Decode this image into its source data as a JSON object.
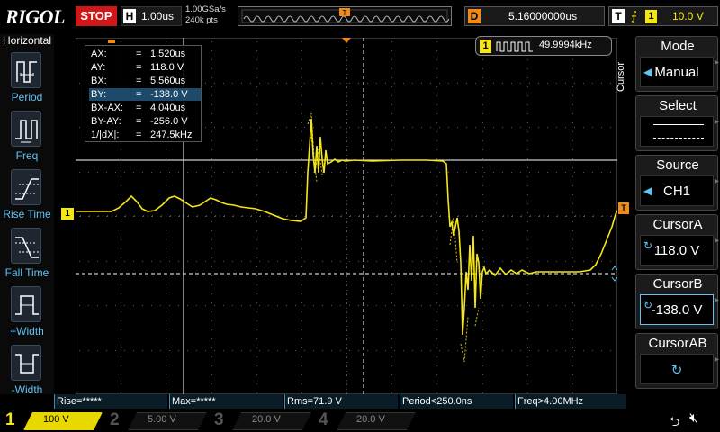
{
  "topbar": {
    "brand": "RIGOL",
    "run_state": "STOP",
    "timebase_tag": "H",
    "timebase": "1.00us",
    "sample_rate": "1.00GSa/s",
    "memory_depth": "240k pts",
    "trigger_position_marker": "T",
    "delay_tag": "D",
    "delay": "5.16000000us",
    "trigger_tag": "T",
    "trigger_edge_icon": "rising-edge-icon",
    "trigger_source": "1",
    "trigger_level": "10.0 V"
  },
  "left_panel": {
    "title": "Horizontal",
    "items": [
      {
        "label": "Period",
        "icon": "period-icon"
      },
      {
        "label": "Freq",
        "icon": "frequency-icon"
      },
      {
        "label": "Rise Time",
        "icon": "rise-time-icon"
      },
      {
        "label": "Fall Time",
        "icon": "fall-time-icon"
      },
      {
        "label": "+Width",
        "icon": "positive-width-icon"
      },
      {
        "label": "-Width",
        "icon": "negative-width-icon"
      }
    ]
  },
  "cursor_readout": [
    {
      "key": "AX:",
      "eq": "=",
      "val": "1.520us"
    },
    {
      "key": "AY:",
      "eq": "=",
      "val": "118.0 V"
    },
    {
      "key": "BX:",
      "eq": "=",
      "val": "5.560us"
    },
    {
      "key": "BY:",
      "eq": "=",
      "val": "-138.0 V"
    },
    {
      "key": "BX-AX:",
      "eq": "=",
      "val": "4.040us"
    },
    {
      "key": "BY-AY:",
      "eq": "=",
      "val": "-256.0 V"
    },
    {
      "key": "1/|dX|:",
      "eq": "=",
      "val": "247.5kHz"
    }
  ],
  "freq_counter": {
    "channel": "1",
    "value": "49.9994kHz"
  },
  "markers": {
    "channel1": "1",
    "trigger_level": "T"
  },
  "measurements": [
    {
      "label": "Rise=*****"
    },
    {
      "label": "Max=*****"
    },
    {
      "label": "Rms=71.9 V"
    },
    {
      "label": "Period<250.0ns"
    },
    {
      "label": "Freq>4.00MHz"
    }
  ],
  "channels": [
    {
      "num": "1",
      "coupling": "",
      "scale": "100 V",
      "active": true
    },
    {
      "num": "2",
      "coupling": "",
      "scale": "5.00 V",
      "active": false
    },
    {
      "num": "3",
      "coupling": "",
      "scale": "20.0 V",
      "active": false
    },
    {
      "num": "4",
      "coupling": "",
      "scale": "20.0 V",
      "active": false
    }
  ],
  "status_icons": {
    "usb": "usb-icon",
    "speaker": "speaker-muted-icon"
  },
  "right_menu": {
    "vertical_title": "Cursor",
    "mode": {
      "label": "Mode",
      "value": "Manual"
    },
    "select": {
      "label": "Select"
    },
    "source": {
      "label": "Source",
      "value": "CH1"
    },
    "cursor_a": {
      "label": "CursorA",
      "value": "118.0 V"
    },
    "cursor_b": {
      "label": "CursorB",
      "value": "-138.0 V"
    },
    "cursor_ab": {
      "label": "CursorAB"
    }
  },
  "colors": {
    "ch1": "#f5e616",
    "trigger": "#f08a18",
    "stop": "#d01818",
    "accent": "#5fc3f5"
  }
}
